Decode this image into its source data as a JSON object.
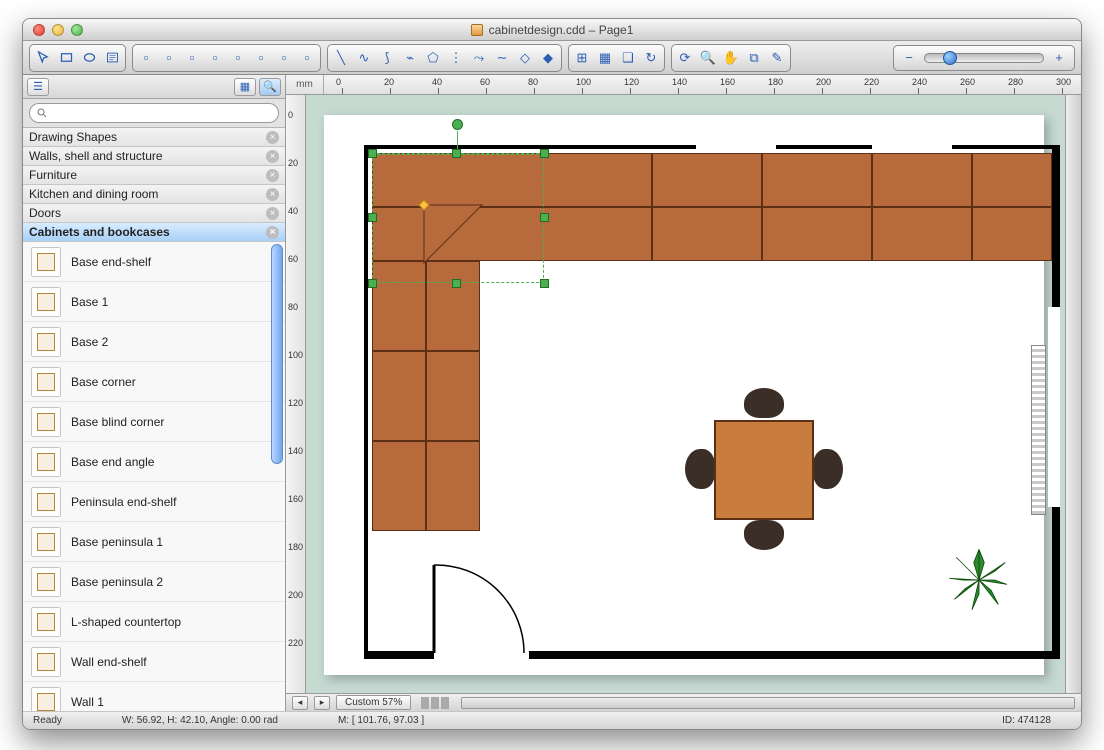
{
  "window": {
    "title": "cabinetdesign.cdd – Page1"
  },
  "ruler": {
    "unit": "mm",
    "h_ticks": [
      0,
      20,
      40,
      60,
      80,
      100,
      120,
      140,
      160,
      180,
      200,
      220,
      240,
      260,
      280,
      300
    ],
    "v_ticks": [
      0,
      20,
      40,
      60,
      80,
      100,
      120,
      140,
      160,
      180,
      200,
      220
    ]
  },
  "sidebar": {
    "search_placeholder": "",
    "categories": [
      {
        "label": "Drawing Shapes",
        "active": false
      },
      {
        "label": "Walls, shell and structure",
        "active": false
      },
      {
        "label": "Furniture",
        "active": false
      },
      {
        "label": "Kitchen and dining room",
        "active": false
      },
      {
        "label": "Doors",
        "active": false
      },
      {
        "label": "Cabinets and bookcases",
        "active": true
      }
    ],
    "shapes": [
      {
        "label": "Base end-shelf"
      },
      {
        "label": "Base 1"
      },
      {
        "label": "Base 2"
      },
      {
        "label": "Base corner"
      },
      {
        "label": "Base blind corner"
      },
      {
        "label": "Base end angle"
      },
      {
        "label": "Peninsula end-shelf"
      },
      {
        "label": "Base peninsula 1"
      },
      {
        "label": "Base peninsula 2"
      },
      {
        "label": "L-shaped countertop"
      },
      {
        "label": "Wall end-shelf"
      },
      {
        "label": "Wall 1"
      }
    ]
  },
  "bottombar": {
    "zoom_label": "Custom 57%"
  },
  "status": {
    "ready": "Ready",
    "dims": "W: 56.92,  H: 42.10,  Angle: 0.00 rad",
    "mouse": "M: [ 101.76, 97.03 ]",
    "id": "ID: 474128"
  },
  "toolbar_icons": {
    "arrow": "arrow",
    "rect": "rectangle",
    "ellipse": "ellipse",
    "text": "text-tool",
    "grp1": [
      "align-left",
      "align-center",
      "align-right",
      "align-top",
      "align-bottom",
      "distribute",
      "group",
      "ungroup"
    ],
    "grp2": [
      "line",
      "curve",
      "arc",
      "polyline",
      "polygon",
      "points",
      "bezier",
      "spline",
      "shape1",
      "shape2"
    ],
    "grp3": [
      "snap",
      "grid",
      "layers",
      "rotate"
    ],
    "grp4": [
      "refresh",
      "zoom-tool",
      "pan",
      "zoom-region",
      "eyedropper"
    ]
  }
}
